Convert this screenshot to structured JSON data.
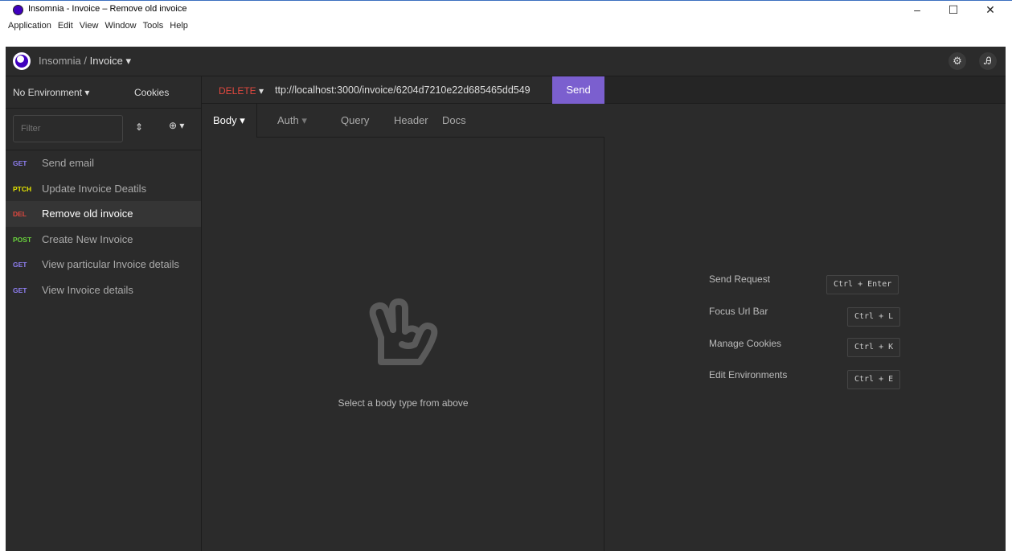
{
  "window": {
    "title": "Insomnia - Invoice – Remove old invoice",
    "controls": {
      "minimize": "–",
      "maximize": "☐",
      "close": "✕"
    }
  },
  "menu": [
    "Application",
    "Edit",
    "View",
    "Window",
    "Tools",
    "Help"
  ],
  "header": {
    "app": "Insomnia",
    "separator": "/",
    "workspace": "Invoice",
    "caret": "▾",
    "settings_icon": "gear-icon",
    "account_icon": "user-icon"
  },
  "sidebar": {
    "environment": "No Environment",
    "cookies": "Cookies",
    "filter_placeholder": "Filter",
    "requests": [
      {
        "method": "GET",
        "name": "Send email",
        "color": "#8e7ef0"
      },
      {
        "method": "PTCH",
        "name": "Update Invoice Deatils",
        "color": "#e5e500"
      },
      {
        "method": "DEL",
        "name": "Remove old invoice",
        "color": "#e0483f"
      },
      {
        "method": "POST",
        "name": "Create New Invoice",
        "color": "#6ad33d"
      },
      {
        "method": "GET",
        "name": "View particular Invoice details",
        "color": "#8e7ef0"
      },
      {
        "method": "GET",
        "name": "View Invoice details",
        "color": "#8e7ef0"
      }
    ],
    "active_index": 2
  },
  "request": {
    "method": "DELETE",
    "url": "ttp://localhost:3000/invoice/6204d7210e22d685465dd549",
    "send_label": "Send",
    "tabs": [
      "Body",
      "Auth",
      "Query",
      "Header",
      "Docs"
    ],
    "body_hint": "Select a body type from above"
  },
  "shortcuts": [
    {
      "label": "Send Request",
      "keys": "Ctrl + Enter"
    },
    {
      "label": "Focus Url Bar",
      "keys": "Ctrl + L"
    },
    {
      "label": "Manage Cookies",
      "keys": "Ctrl + K"
    },
    {
      "label": "Edit Environments",
      "keys": "Ctrl + E"
    }
  ]
}
